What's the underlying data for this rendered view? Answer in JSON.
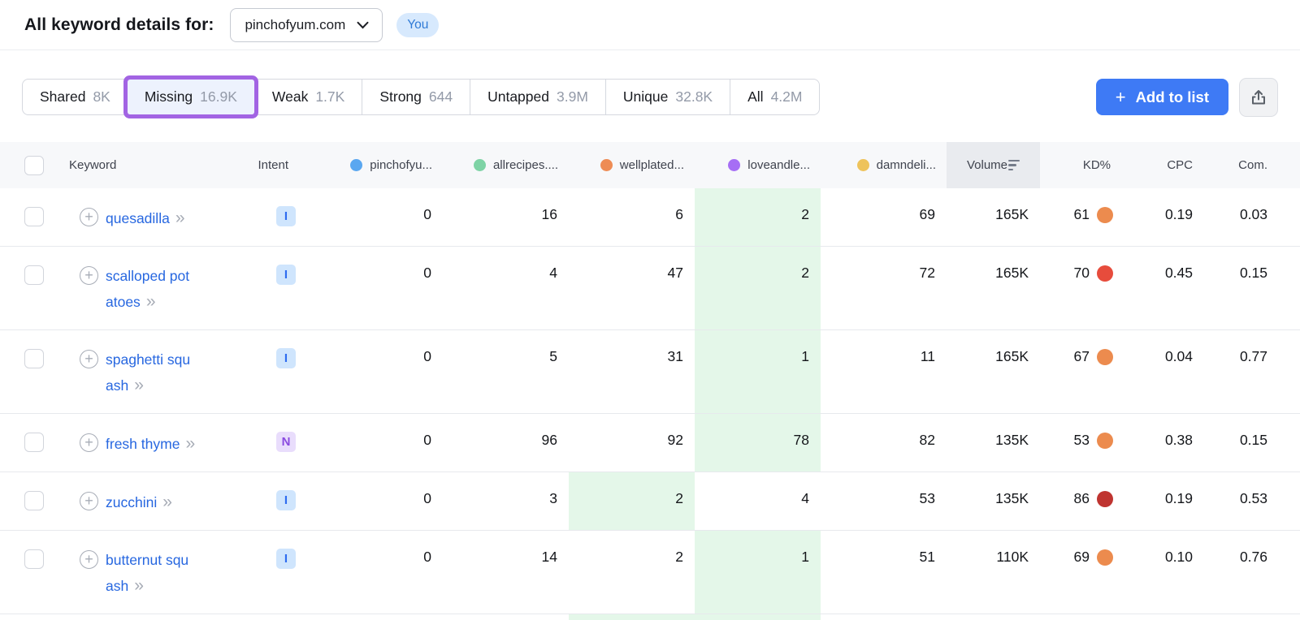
{
  "header": {
    "title": "All keyword details for:",
    "domain": "pinchofyum.com",
    "you_badge": "You"
  },
  "tabs": [
    {
      "label": "Shared",
      "count": "8K"
    },
    {
      "label": "Missing",
      "count": "16.9K",
      "active": true
    },
    {
      "label": "Weak",
      "count": "1.7K"
    },
    {
      "label": "Strong",
      "count": "644"
    },
    {
      "label": "Untapped",
      "count": "3.9M"
    },
    {
      "label": "Unique",
      "count": "32.8K"
    },
    {
      "label": "All",
      "count": "4.2M"
    }
  ],
  "actions": {
    "add_to_list": "Add to list",
    "plus": "+"
  },
  "table": {
    "columns": {
      "keyword": "Keyword",
      "intent": "Intent",
      "volume": "Volume",
      "kd": "KD%",
      "cpc": "CPC",
      "com": "Com."
    },
    "competitors": [
      {
        "label": "pinchofyu...",
        "color": "#5aa7f0"
      },
      {
        "label": "allrecipes....",
        "color": "#7ed3a5"
      },
      {
        "label": "wellplated...",
        "color": "#ee8c55"
      },
      {
        "label": "loveandle...",
        "color": "#a66ef5"
      },
      {
        "label": "damndeli...",
        "color": "#eec35b"
      }
    ],
    "intent_styles": {
      "I": {
        "bg": "#cfe5fd",
        "fg": "#2e6cf0"
      },
      "N": {
        "bg": "#e9ddfc",
        "fg": "#8a4be0"
      }
    },
    "highlight_color": "#e4f7e9",
    "expand_glyph": "»",
    "rows": [
      {
        "lines": [
          "quesadilla"
        ],
        "intent": "I",
        "positions": [
          "0",
          "16",
          "6",
          "2",
          "69"
        ],
        "highlight": 3,
        "volume": "165K",
        "kd": "61",
        "kd_color": "#ec8b4e",
        "cpc": "0.19",
        "com": "0.03"
      },
      {
        "lines": [
          "scalloped pot",
          "atoes"
        ],
        "intent": "I",
        "positions": [
          "0",
          "4",
          "47",
          "2",
          "72"
        ],
        "highlight": 3,
        "volume": "165K",
        "kd": "70",
        "kd_color": "#e74c3c",
        "cpc": "0.45",
        "com": "0.15"
      },
      {
        "lines": [
          "spaghetti squ",
          "ash"
        ],
        "intent": "I",
        "positions": [
          "0",
          "5",
          "31",
          "1",
          "11"
        ],
        "highlight": 3,
        "volume": "165K",
        "kd": "67",
        "kd_color": "#ec8b4e",
        "cpc": "0.04",
        "com": "0.77"
      },
      {
        "lines": [
          "fresh thyme"
        ],
        "intent": "N",
        "positions": [
          "0",
          "96",
          "92",
          "78",
          "82"
        ],
        "highlight": 3,
        "volume": "135K",
        "kd": "53",
        "kd_color": "#ec8b4e",
        "cpc": "0.38",
        "com": "0.15"
      },
      {
        "lines": [
          "zucchini"
        ],
        "intent": "I",
        "positions": [
          "0",
          "3",
          "2",
          "4",
          "53"
        ],
        "highlight": 2,
        "volume": "135K",
        "kd": "86",
        "kd_color": "#bf3430",
        "cpc": "0.19",
        "com": "0.53"
      },
      {
        "lines": [
          "butternut squ",
          "ash"
        ],
        "intent": "I",
        "positions": [
          "0",
          "14",
          "2",
          "1",
          "51"
        ],
        "highlight": 3,
        "volume": "110K",
        "kd": "69",
        "kd_color": "#ec8b4e",
        "cpc": "0.10",
        "com": "0.76"
      }
    ]
  }
}
